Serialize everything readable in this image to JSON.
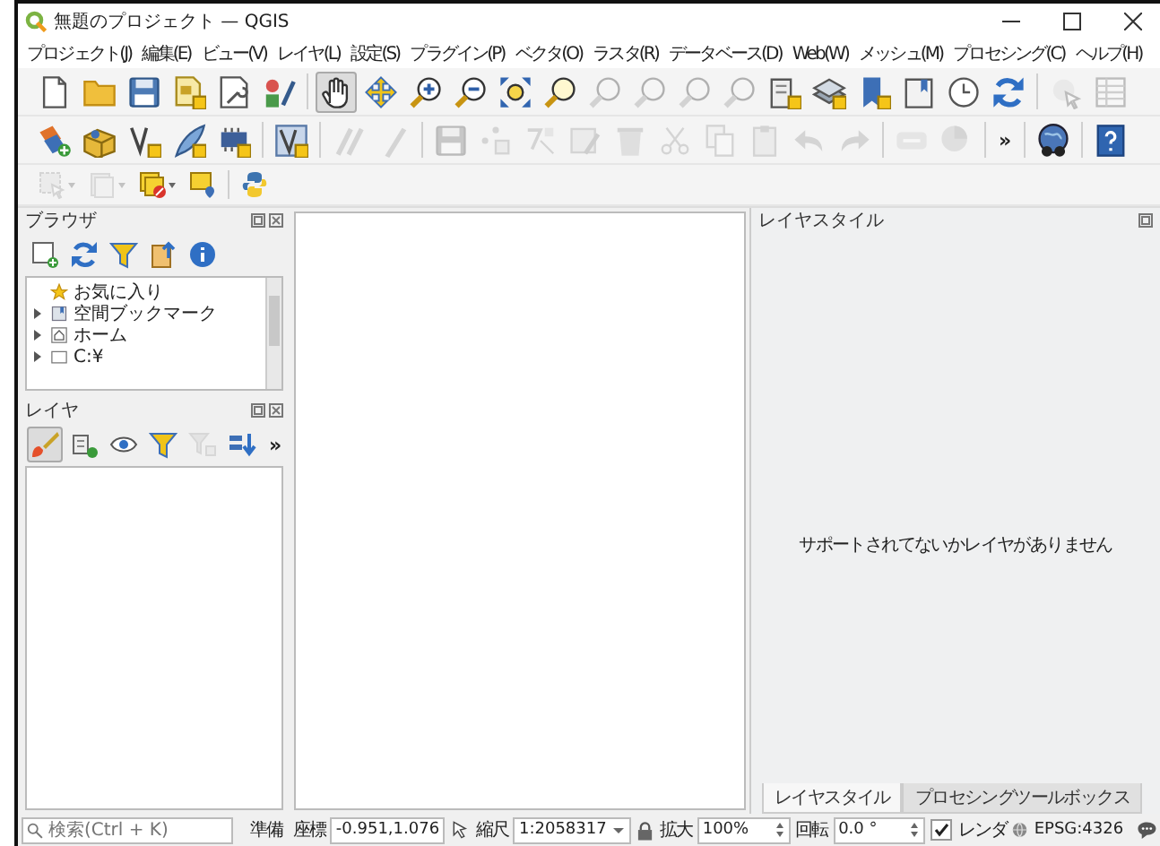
{
  "window": {
    "title": "無題のプロジェクト — QGIS"
  },
  "menu": [
    "プロジェクト(J)",
    "編集(E)",
    "ビュー(V)",
    "レイヤ(L)",
    "設定(S)",
    "プラグイン(P)",
    "ベクタ(O)",
    "ラスタ(R)",
    "データベース(D)",
    "Web(W)",
    "メッシュ(M)",
    "プロセシング(C)",
    "ヘルプ(H)"
  ],
  "toolbars": [
    {
      "items": [
        {
          "kind": "tool",
          "disabled": false,
          "selected": false
        },
        {
          "kind": "tool",
          "disabled": false,
          "selected": false
        },
        {
          "kind": "tool",
          "disabled": false,
          "selected": false
        },
        {
          "kind": "tool",
          "disabled": false,
          "selected": false
        },
        {
          "kind": "tool",
          "disabled": false,
          "selected": false
        },
        {
          "kind": "tool",
          "disabled": false,
          "selected": false
        },
        {
          "kind": "tool",
          "disabled": false,
          "selected": true
        },
        {
          "kind": "tool",
          "disabled": false,
          "selected": false
        },
        {
          "kind": "tool",
          "disabled": false,
          "selected": false
        },
        {
          "kind": "tool",
          "disabled": false,
          "selected": false
        },
        {
          "kind": "tool",
          "disabled": false,
          "selected": false
        },
        {
          "kind": "tool",
          "disabled": false,
          "selected": false
        },
        {
          "kind": "tool",
          "disabled": true,
          "selected": false
        },
        {
          "kind": "tool",
          "disabled": true,
          "selected": false
        },
        {
          "kind": "tool",
          "disabled": true,
          "selected": false
        },
        {
          "kind": "tool",
          "disabled": true,
          "selected": false
        },
        {
          "kind": "tool",
          "disabled": false,
          "selected": false
        },
        {
          "kind": "tool",
          "disabled": false,
          "selected": false
        },
        {
          "kind": "tool",
          "disabled": false,
          "selected": false
        },
        {
          "kind": "tool",
          "disabled": false,
          "selected": false
        },
        {
          "kind": "tool",
          "disabled": false,
          "selected": false
        },
        {
          "kind": "tool",
          "disabled": false,
          "selected": false
        },
        {
          "kind": "tool",
          "disabled": true,
          "selected": false
        },
        {
          "kind": "tool",
          "disabled": true,
          "selected": false
        }
      ]
    },
    {
      "items": [
        {
          "kind": "tool",
          "disabled": false,
          "selected": false
        },
        {
          "kind": "tool",
          "disabled": false,
          "selected": false
        },
        {
          "kind": "tool",
          "disabled": false,
          "selected": false
        },
        {
          "kind": "tool",
          "disabled": false,
          "selected": false
        },
        {
          "kind": "tool",
          "disabled": false,
          "selected": false
        },
        {
          "kind": "tool",
          "disabled": false,
          "selected": false
        },
        {
          "kind": "tool",
          "disabled": true,
          "selected": false
        },
        {
          "kind": "tool",
          "disabled": true,
          "selected": false
        },
        {
          "kind": "tool",
          "disabled": true,
          "selected": false
        },
        {
          "kind": "tool",
          "disabled": true,
          "selected": false
        },
        {
          "kind": "tool",
          "disabled": true,
          "selected": false
        },
        {
          "kind": "tool",
          "disabled": true,
          "selected": false
        },
        {
          "kind": "tool",
          "disabled": true,
          "selected": false
        },
        {
          "kind": "tool",
          "disabled": true,
          "selected": false
        },
        {
          "kind": "tool",
          "disabled": true,
          "selected": false
        },
        {
          "kind": "tool",
          "disabled": true,
          "selected": false
        },
        {
          "kind": "tool",
          "disabled": true,
          "selected": false
        },
        {
          "kind": "tool",
          "disabled": true,
          "selected": false
        },
        {
          "kind": "tool",
          "disabled": true,
          "selected": false
        },
        {
          "kind": "tool",
          "disabled": true,
          "selected": false
        },
        {
          "kind": "more",
          "label": "»"
        },
        {
          "kind": "tool",
          "disabled": false,
          "selected": false
        },
        {
          "kind": "tool",
          "disabled": false,
          "selected": false
        }
      ]
    },
    {
      "items": [
        {
          "kind": "tool",
          "disabled": true,
          "selected": false
        },
        {
          "kind": "tool",
          "disabled": true,
          "selected": false
        },
        {
          "kind": "tool",
          "disabled": false,
          "selected": false
        },
        {
          "kind": "tool",
          "disabled": false,
          "selected": false
        },
        {
          "kind": "tool",
          "disabled": false,
          "selected": false
        }
      ]
    }
  ],
  "browser": {
    "title": "ブラウザ",
    "toolbar": [
      {
        "kind": "tool",
        "disabled": false,
        "selected": false
      },
      {
        "kind": "tool",
        "disabled": false,
        "selected": false
      },
      {
        "kind": "tool",
        "disabled": false,
        "selected": false
      },
      {
        "kind": "tool",
        "disabled": false,
        "selected": false
      },
      {
        "kind": "tool",
        "disabled": false,
        "selected": false
      }
    ],
    "items": [
      {
        "kind": "favorites",
        "label": "お気に入り"
      },
      {
        "kind": "bookmarks",
        "label": "空間ブックマーク",
        "expanded": false
      },
      {
        "kind": "home",
        "label": "ホーム",
        "expanded": false
      },
      {
        "kind": "drive",
        "label": "C:¥",
        "expanded": false
      }
    ]
  },
  "layers": {
    "title": "レイヤ",
    "toolbar": [
      {
        "kind": "tool",
        "disabled": false,
        "selected": true
      },
      {
        "kind": "tool",
        "disabled": false,
        "selected": false
      },
      {
        "kind": "tool",
        "disabled": false,
        "selected": false
      },
      {
        "kind": "tool",
        "disabled": false,
        "selected": false
      },
      {
        "kind": "tool",
        "disabled": true,
        "selected": false
      },
      {
        "kind": "tool",
        "disabled": false,
        "selected": false
      },
      {
        "kind": "more",
        "label": "»"
      }
    ]
  },
  "layer_style": {
    "title": "レイヤスタイル",
    "message": "サポートされてないかレイヤがありません"
  },
  "tabs": [
    {
      "label": "レイヤスタイル",
      "selected": true
    },
    {
      "label": "プロセシングツールボックス",
      "selected": false
    }
  ],
  "status_bar": {
    "search": {
      "placeholder": "検索(Ctrl + K)"
    },
    "message": "準備",
    "coordinate": {
      "label": "座標",
      "value": "-0.951,1.076"
    },
    "scale": {
      "label": "縮尺",
      "value": "1:2058317"
    },
    "magnifier": {
      "label": "拡大",
      "value": "100%"
    },
    "rotation": {
      "label": "回転",
      "value": "0.0 °"
    },
    "render": {
      "label": "レンダ",
      "checked": true
    },
    "crs": "EPSG:4326"
  }
}
